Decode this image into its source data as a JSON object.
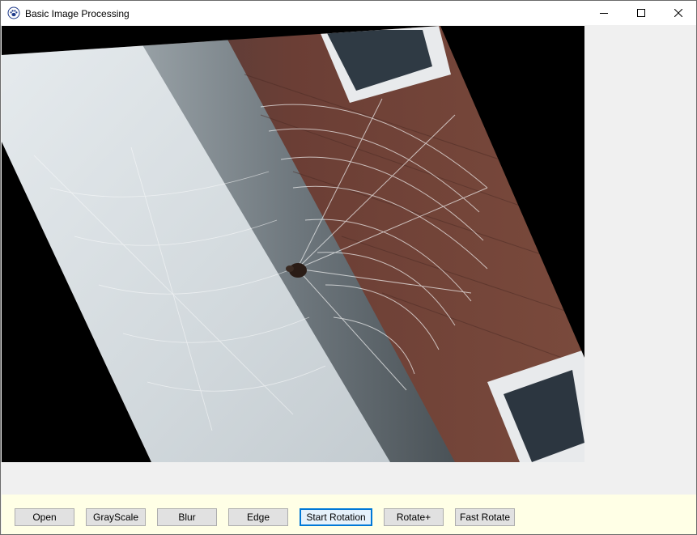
{
  "window": {
    "title": "Basic Image Processing",
    "app_icon": "paw-icon",
    "controls": [
      "minimize-icon",
      "maximize-icon",
      "close-icon"
    ]
  },
  "image": {
    "description_icon": "rotated-photo",
    "rotation_state": "rotated"
  },
  "toolbar": {
    "buttons": [
      {
        "label": "Open"
      },
      {
        "label": "GrayScale"
      },
      {
        "label": "Blur"
      },
      {
        "label": "Edge"
      },
      {
        "label": "Start Rotation"
      },
      {
        "label": "Rotate+"
      },
      {
        "label": "Fast Rotate"
      }
    ]
  },
  "colors": {
    "titlebar_bg": "#ffffff",
    "window_bg": "#f0f0f0",
    "toolbar_bg": "#ffffe6",
    "button_bg": "#e1e1e1",
    "button_border": "#adadad",
    "focus_border": "#0078d7",
    "canvas_bg": "#000000"
  }
}
